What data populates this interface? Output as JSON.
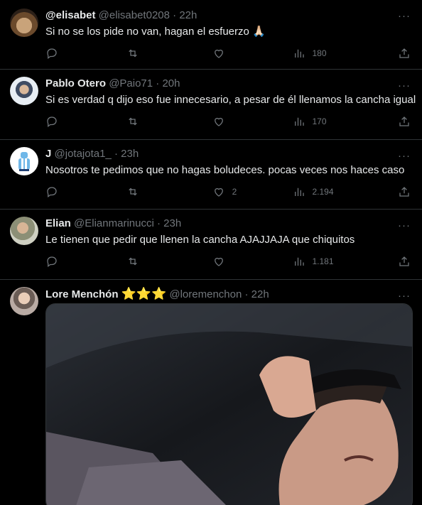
{
  "icons": {
    "reply": "reply-icon",
    "retweet": "retweet-icon",
    "like": "like-icon",
    "views": "views-icon",
    "share": "share-icon",
    "more": "more-icon",
    "star": "star-icon"
  },
  "colors": {
    "background": "#000000",
    "text": "#e7e9ea",
    "secondary": "#71767b",
    "border": "#2f3336",
    "star": "#f4b400"
  },
  "tweets": [
    {
      "name": "@elisabet",
      "handle": "@elisabet0208",
      "sep": "·",
      "time": "22h",
      "text": "Si no se los pide no van, hagan el esfuerzo 🙏🏻",
      "replies": "",
      "retweets": "",
      "likes": "",
      "views": "180",
      "more": "···"
    },
    {
      "name": "Pablo Otero",
      "handle": "@Paio71",
      "sep": "·",
      "time": "20h",
      "text": "Si es verdad q dijo eso fue innecesario, a pesar de él llenamos la cancha igual",
      "replies": "",
      "retweets": "",
      "likes": "",
      "views": "170",
      "more": "···"
    },
    {
      "name": "J",
      "handle": "@jotajota1_",
      "sep": "·",
      "time": "23h",
      "text": "Nosotros te pedimos que no hagas boludeces. pocas veces nos haces caso",
      "replies": "",
      "retweets": "",
      "likes": "2",
      "views": "2.194",
      "more": "···"
    },
    {
      "name": "Elian",
      "handle": "@Elianmarinucci",
      "sep": "·",
      "time": "23h",
      "text": "Le tienen que pedir que llenen la cancha AJAJJAJA que chiquitos",
      "replies": "",
      "retweets": "",
      "likes": "",
      "views": "1.181",
      "more": "···"
    },
    {
      "name": "Lore Menchón",
      "stars": "⭐⭐⭐",
      "handle": "@loremenchon",
      "sep": "·",
      "time": "22h",
      "more": "···"
    }
  ]
}
